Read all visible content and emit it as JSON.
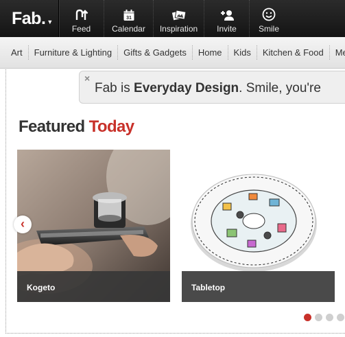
{
  "logo": "Fab.",
  "nav": [
    {
      "label": "Feed",
      "icon": "feed-icon"
    },
    {
      "label": "Calendar",
      "icon": "calendar-icon",
      "badge": "31"
    },
    {
      "label": "Inspiration",
      "icon": "inspiration-icon"
    },
    {
      "label": "Invite",
      "icon": "invite-icon"
    },
    {
      "label": "Smile",
      "icon": "smile-icon"
    }
  ],
  "categories": [
    "Art",
    "Furniture & Lighting",
    "Gifts & Gadgets",
    "Home",
    "Kids",
    "Kitchen & Food",
    "Men's"
  ],
  "banner": {
    "close": "×",
    "prefix": "Fab is ",
    "bold": "Everyday Design",
    "suffix": ". Smile, you're"
  },
  "featured": {
    "word1": "Featured",
    "word2": "Today"
  },
  "cards": [
    {
      "title": "Kogeto"
    },
    {
      "title": "Tabletop"
    }
  ],
  "carousel": {
    "prev": "‹",
    "dots": 4,
    "active_dot": 1
  },
  "colors": {
    "accent": "#c8312a",
    "topbar": "#1c1c1c"
  }
}
